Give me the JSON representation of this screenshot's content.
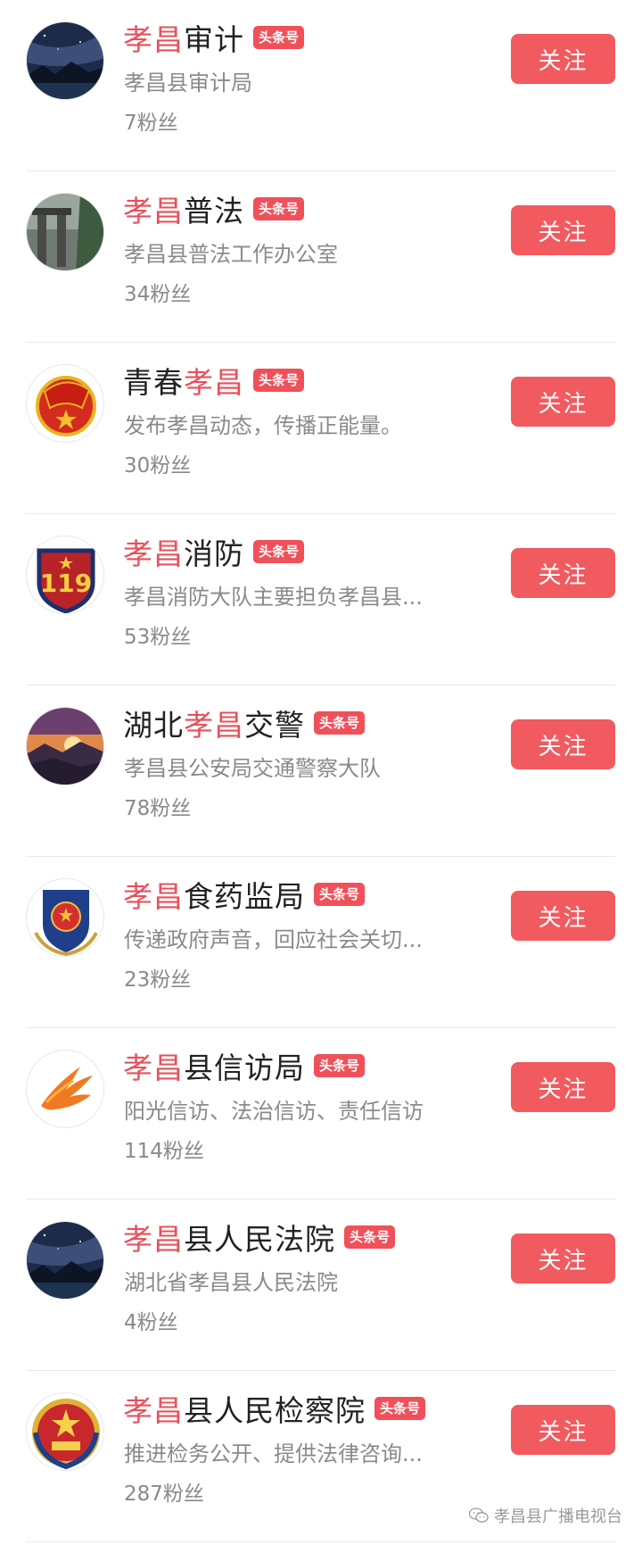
{
  "accounts": [
    {
      "name_hl": "孝昌",
      "name_rest": "审计",
      "badge": "头条号",
      "desc": "孝昌县审计局",
      "fans": "7粉丝",
      "follow_label": "关注",
      "avatar": "night-sky-avatar"
    },
    {
      "name_hl": "孝昌",
      "name_rest": "普法",
      "badge": "头条号",
      "desc": "孝昌县普法工作办公室",
      "fans": "34粉丝",
      "follow_label": "关注",
      "avatar": "stone-arch-avatar"
    },
    {
      "name_pre": "青春",
      "name_hl": "孝昌",
      "badge": "头条号",
      "desc": "发布孝昌动态，传播正能量。",
      "fans": "30粉丝",
      "follow_label": "关注",
      "avatar": "youth-league-emblem-avatar"
    },
    {
      "name_hl": "孝昌",
      "name_rest": "消防",
      "badge": "头条号",
      "desc": "孝昌消防大队主要担负孝昌县...",
      "fans": "53粉丝",
      "follow_label": "关注",
      "avatar": "fire-119-emblem-avatar"
    },
    {
      "name_pre": "湖北",
      "name_hl": "孝昌",
      "name_rest": "交警",
      "badge": "头条号",
      "desc": "孝昌县公安局交通警察大队",
      "fans": "78粉丝",
      "follow_label": "关注",
      "avatar": "sunset-mountain-avatar"
    },
    {
      "name_hl": "孝昌",
      "name_rest": "食药监局",
      "badge": "头条号",
      "desc": "传递政府声音，回应社会关切...",
      "fans": "23粉丝",
      "follow_label": "关注",
      "avatar": "national-emblem-shield-avatar"
    },
    {
      "name_hl": "孝昌",
      "name_rest": "县信访局",
      "badge": "头条号",
      "desc": "阳光信访、法治信访、责任信访",
      "fans": "114粉丝",
      "follow_label": "关注",
      "avatar": "orange-phoenix-logo-avatar"
    },
    {
      "name_hl": "孝昌",
      "name_rest": "县人民法院",
      "badge": "头条号",
      "desc": "湖北省孝昌县人民法院",
      "fans": "4粉丝",
      "follow_label": "关注",
      "avatar": "night-sky-avatar"
    },
    {
      "name_hl": "孝昌",
      "name_rest": "县人民检察院",
      "badge": "头条号",
      "desc": "推进检务公开、提供法律咨询...",
      "fans": "287粉丝",
      "follow_label": "关注",
      "avatar": "procuratorate-emblem-avatar"
    }
  ],
  "watermark": {
    "text": "孝昌县广播电视台",
    "icon": "wechat-icon"
  },
  "colors": {
    "highlight": "#e8505b",
    "button": "#f15a5f",
    "badge": "#f0505a"
  }
}
